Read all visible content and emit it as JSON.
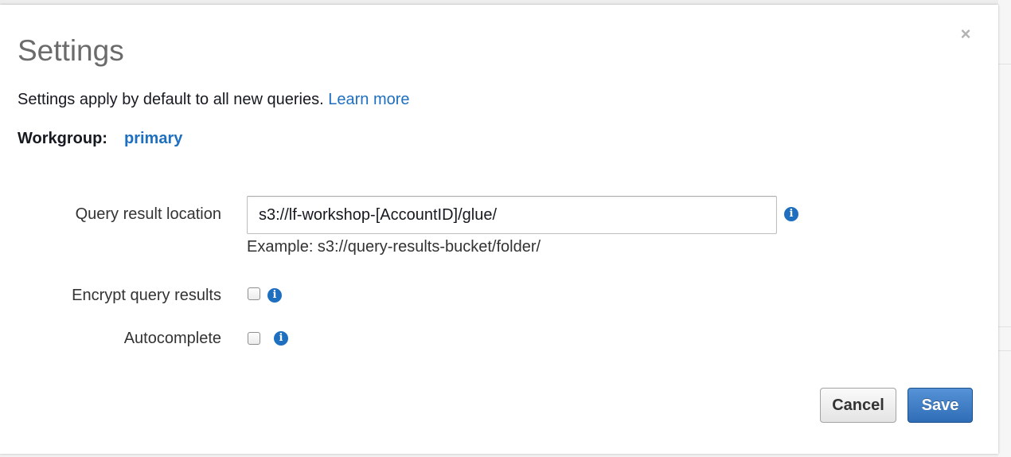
{
  "dialog": {
    "title": "Settings",
    "close_glyph": "×",
    "subtitle": "Settings apply by default to all new queries.",
    "learn_more": "Learn more",
    "workgroup_label": "Workgroup:",
    "workgroup_value": "primary"
  },
  "form": {
    "query_result_location": {
      "label": "Query result location",
      "value": "s3://lf-workshop-[AccountID]/glue/",
      "hint": "Example: s3://query-results-bucket/folder/"
    },
    "encrypt_query_results": {
      "label": "Encrypt query results",
      "checked": false
    },
    "autocomplete": {
      "label": "Autocomplete",
      "checked": false
    },
    "info_glyph": "i"
  },
  "actions": {
    "cancel_label": "Cancel",
    "save_label": "Save"
  },
  "colors": {
    "link": "#1e6fbf",
    "primary_button": "#2f6db7",
    "title": "#6b6b6b"
  },
  "icons": [
    "close-icon",
    "info-icon"
  ]
}
